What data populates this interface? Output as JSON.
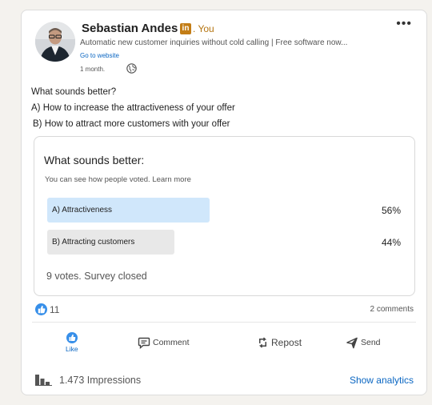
{
  "author": {
    "name": "Sebastian Andes",
    "badge": "in",
    "you_label": ". You",
    "headline": "Automatic new customer inquiries without cold calling | Free software now...",
    "website_link": "Go to website",
    "time": "1 month."
  },
  "post": {
    "lines": [
      "What sounds better?",
      "A) How to increase the attractiveness of your offer",
      "B) How to attract more customers with your offer"
    ]
  },
  "poll": {
    "question": "What sounds better:",
    "note": "You can see how people voted. Learn more",
    "options": [
      {
        "label": "A) Attractiveness",
        "percent": "56%",
        "fraction": 0.56,
        "selected": true
      },
      {
        "label": "B) Attracting customers",
        "percent": "44%",
        "fraction": 0.44,
        "selected": false
      }
    ],
    "footer": "9 votes. Survey closed"
  },
  "social": {
    "reaction_count": "11",
    "comments": "2 comments"
  },
  "actions": {
    "like": "Like",
    "comment": "Comment",
    "repost": "Repost",
    "send": "Send"
  },
  "footer": {
    "impressions": "1.473 Impressions",
    "analytics": "Show analytics"
  },
  "colors": {
    "accent_blue": "#0a66c2",
    "selected_bar": "#d0e7fb",
    "unselected_bar": "#e8e8e8",
    "premium_gold": "#c37d16"
  },
  "icons": [
    "more-icon",
    "globe-icon",
    "like-reaction-icon",
    "like-icon",
    "comment-icon",
    "repost-icon",
    "send-icon",
    "bar-chart-icon"
  ]
}
